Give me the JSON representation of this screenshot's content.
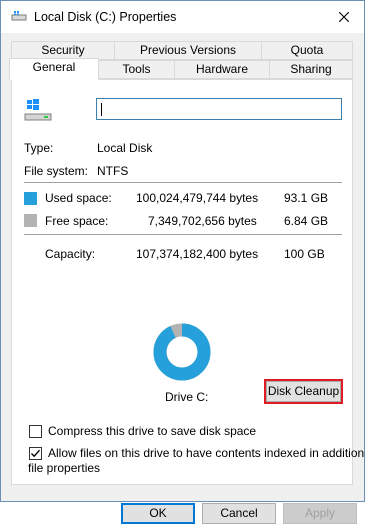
{
  "window": {
    "title": "Local Disk (C:) Properties"
  },
  "tabs": {
    "row1": [
      "Security",
      "Previous Versions",
      "Quota"
    ],
    "row2": [
      "General",
      "Tools",
      "Hardware",
      "Sharing"
    ],
    "active": "General"
  },
  "general": {
    "drive_name_value": "",
    "type_label": "Type:",
    "type_value": "Local Disk",
    "fs_label": "File system:",
    "fs_value": "NTFS",
    "used_label": "Used space:",
    "used_bytes": "100,024,479,744 bytes",
    "used_size": "93.1 GB",
    "free_label": "Free space:",
    "free_bytes": "7,349,702,656 bytes",
    "free_size": "6.84 GB",
    "capacity_label": "Capacity:",
    "capacity_bytes": "107,374,182,400 bytes",
    "capacity_size": "100 GB",
    "drive_label": "Drive C:",
    "cleanup_label": "Disk Cleanup",
    "compress_label": "Compress this drive to save disk space",
    "compress_checked": false,
    "index_label_line1": "Allow files on this drive to have contents indexed in addition to",
    "index_label_line2": "file properties",
    "index_checked": true
  },
  "usage": {
    "used_fraction": 0.9316,
    "used_color": "#26a0da",
    "free_color": "#b3b3b3"
  },
  "buttons": {
    "ok": "OK",
    "cancel": "Cancel",
    "apply": "Apply"
  }
}
